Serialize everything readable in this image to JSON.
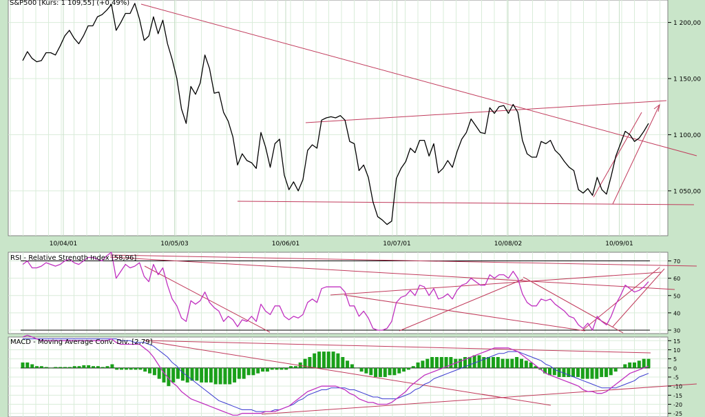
{
  "colors": {
    "background": "#c9e5c9",
    "panel": "#ffffff",
    "grid": "#d9ecd9",
    "price_line": "#000000",
    "trendline": "#c0395a",
    "oscillator": "#c030c0",
    "signal": "#3a3ad0",
    "histogram": "#1aa01a",
    "border": "#808080"
  },
  "chart_data": [
    {
      "type": "line",
      "title": "S&P500 [Kurs: 1 109,55] (+0,49%)",
      "x_labels": [
        "10/04/01",
        "10/05/03",
        "10/06/01",
        "10/07/01",
        "10/08/02",
        "10/09/01"
      ],
      "y_ticks": [
        "1 200,00",
        "1 150,00",
        "1 100,00",
        "1 050,00"
      ],
      "ylim": [
        1010,
        1220
      ],
      "grid": true,
      "series": [
        {
          "values": [
            1166,
            1174,
            1168,
            1165,
            1166,
            1173,
            1173,
            1171,
            1179,
            1188,
            1193,
            1186,
            1181,
            1188,
            1197,
            1197,
            1205,
            1207,
            1211,
            1216,
            1193,
            1200,
            1208,
            1208,
            1217,
            1203,
            1184,
            1188,
            1205,
            1190,
            1202,
            1181,
            1167,
            1150,
            1123,
            1110,
            1143,
            1136,
            1146,
            1171,
            1159,
            1137,
            1138,
            1120,
            1112,
            1098,
            1073,
            1083,
            1077,
            1075,
            1070,
            1102,
            1089,
            1071,
            1092,
            1096,
            1064,
            1051,
            1058,
            1050,
            1060,
            1086,
            1091,
            1088,
            1113,
            1115,
            1116,
            1115,
            1117,
            1113,
            1094,
            1092,
            1068,
            1073,
            1062,
            1040,
            1027,
            1024,
            1020,
            1023,
            1061,
            1070,
            1076,
            1088,
            1084,
            1095,
            1095,
            1081,
            1092,
            1066,
            1070,
            1077,
            1071,
            1085,
            1096,
            1102,
            1114,
            1108,
            1102,
            1101,
            1124,
            1119,
            1125,
            1126,
            1119,
            1127,
            1120,
            1095,
            1083,
            1080,
            1080,
            1094,
            1092,
            1095,
            1086,
            1082,
            1076,
            1071,
            1068,
            1051,
            1048,
            1052,
            1046,
            1062,
            1051,
            1047,
            1063,
            1081,
            1092,
            1103,
            1100,
            1094,
            1097,
            1103,
            1110
          ]
        }
      ]
    },
    {
      "type": "line",
      "title": "RSI - Relative Strength Index [58,96]",
      "y_ticks": [
        "70",
        "60",
        "50",
        "40",
        "30"
      ],
      "ylim": [
        28,
        75
      ],
      "grid": true,
      "series": [
        {
          "values": [
            68,
            70,
            66,
            66,
            67,
            69,
            68,
            67,
            68,
            70,
            71,
            69,
            68,
            70,
            72,
            72,
            71,
            70,
            73,
            75,
            60,
            64,
            68,
            66,
            67,
            69,
            61,
            58,
            68,
            62,
            66,
            56,
            48,
            44,
            37,
            35,
            47,
            45,
            47,
            52,
            46,
            43,
            41,
            35,
            38,
            36,
            32,
            36,
            35,
            38,
            35,
            45,
            41,
            39,
            44,
            44,
            38,
            36,
            38,
            37,
            39,
            46,
            48,
            46,
            54,
            55,
            55,
            55,
            55,
            52,
            44,
            44,
            38,
            41,
            37,
            31,
            30,
            30,
            31,
            35,
            46,
            49,
            50,
            53,
            50,
            56,
            55,
            50,
            54,
            48,
            49,
            51,
            48,
            53,
            56,
            57,
            60,
            58,
            56,
            56,
            62,
            60,
            62,
            62,
            60,
            64,
            60,
            51,
            46,
            44,
            44,
            48,
            47,
            48,
            45,
            43,
            41,
            38,
            37,
            33,
            31,
            34,
            30,
            38,
            35,
            33,
            38,
            45,
            50,
            56,
            54,
            52,
            53,
            55,
            58
          ]
        }
      ]
    },
    {
      "type": "bar",
      "title": "MACD - Moving Average Conv. Div. [2,79]",
      "y_ticks": [
        "15",
        "10",
        "5",
        "0",
        "-5",
        "-10",
        "-15",
        "-20",
        "-25"
      ],
      "ylim": [
        -27,
        17
      ],
      "grid": true,
      "histogram": [
        3,
        3,
        2,
        1,
        1,
        0.5,
        0,
        0.5,
        0.5,
        0.5,
        0.5,
        1,
        1,
        1.5,
        1.5,
        1,
        1,
        0.5,
        1,
        2,
        -1,
        -1,
        -1,
        -1,
        -1,
        -1,
        -2,
        -3,
        -4,
        -6,
        -8,
        -10,
        -8,
        -6,
        -7,
        -8,
        -7,
        -7,
        -8,
        -8,
        -8,
        -9,
        -9,
        -9,
        -9,
        -8,
        -6,
        -6,
        -4,
        -4,
        -3,
        -2,
        -2,
        -1,
        -1,
        -1,
        -1,
        1,
        1,
        3,
        5,
        6,
        8,
        9,
        9,
        9,
        9,
        8,
        6,
        4,
        2,
        0,
        -2,
        -3,
        -4,
        -5,
        -5,
        -5,
        -4,
        -4,
        -3,
        -2,
        -1,
        1,
        3,
        4,
        5,
        6,
        6,
        6,
        6,
        6,
        5,
        5,
        6,
        6,
        7,
        7,
        6,
        6,
        6,
        6,
        5,
        5,
        5,
        6,
        5,
        4,
        3,
        1,
        -1,
        -3,
        -4,
        -4,
        -5,
        -5,
        -5,
        -5,
        -5,
        -6,
        -6,
        -6,
        -6,
        -5,
        -5,
        -4,
        -2,
        0,
        2,
        3,
        3,
        4,
        5,
        5
      ],
      "series": [
        {
          "values": [
            17,
            18,
            17,
            16,
            15,
            15,
            15,
            15,
            15,
            15,
            15,
            15,
            15,
            15,
            15,
            15,
            15,
            15,
            15,
            16,
            14,
            13,
            13,
            13,
            13,
            13,
            11,
            9,
            6,
            2,
            -2,
            -5,
            -8,
            -10,
            -13,
            -15,
            -17,
            -18,
            -19,
            -20,
            -21,
            -22,
            -23,
            -24,
            -25,
            -26,
            -26,
            -25,
            -25,
            -25,
            -25,
            -25,
            -24,
            -24,
            -24,
            -23,
            -22,
            -21,
            -19,
            -17,
            -15,
            -13,
            -12,
            -11,
            -10,
            -10,
            -10,
            -10,
            -11,
            -12,
            -14,
            -15,
            -17,
            -18,
            -19,
            -19,
            -20,
            -20,
            -20,
            -19,
            -17,
            -15,
            -13,
            -10,
            -8,
            -6,
            -4,
            -3,
            -2,
            -1,
            0,
            1,
            2,
            3,
            4,
            5,
            6,
            7,
            8,
            9,
            10,
            11,
            11,
            11,
            11,
            10,
            9,
            7,
            5,
            3,
            1,
            -1,
            -3,
            -4,
            -5,
            -6,
            -7,
            -8,
            -9,
            -10,
            -12,
            -13,
            -13,
            -14,
            -14,
            -13,
            -11,
            -9,
            -7,
            -5,
            -3,
            -2,
            -1,
            0,
            1
          ]
        },
        {
          "values": [
            16,
            16,
            16,
            16,
            16,
            16,
            16,
            16,
            16,
            16,
            16,
            16,
            16,
            16,
            16,
            16,
            16,
            16,
            16,
            16,
            16,
            15,
            15,
            15,
            14,
            14,
            14,
            13,
            12,
            10,
            8,
            6,
            3,
            1,
            -2,
            -4,
            -6,
            -8,
            -10,
            -12,
            -14,
            -16,
            -18,
            -19,
            -20,
            -21,
            -22,
            -23,
            -23,
            -23,
            -24,
            -24,
            -24,
            -24,
            -23,
            -23,
            -22,
            -21,
            -20,
            -18,
            -17,
            -15,
            -14,
            -13,
            -12,
            -12,
            -11,
            -11,
            -11,
            -11,
            -12,
            -12,
            -13,
            -14,
            -15,
            -16,
            -16,
            -17,
            -17,
            -17,
            -17,
            -16,
            -15,
            -14,
            -12,
            -11,
            -9,
            -8,
            -6,
            -5,
            -4,
            -3,
            -2,
            -1,
            0,
            1,
            2,
            3,
            4,
            5,
            6,
            7,
            8,
            8,
            9,
            9,
            9,
            8,
            7,
            6,
            5,
            4,
            2,
            1,
            -1,
            -2,
            -3,
            -4,
            -5,
            -6,
            -7,
            -8,
            -9,
            -10,
            -11,
            -11,
            -11,
            -11,
            -10,
            -9,
            -8,
            -7,
            -5,
            -4,
            -3
          ]
        }
      ]
    }
  ]
}
